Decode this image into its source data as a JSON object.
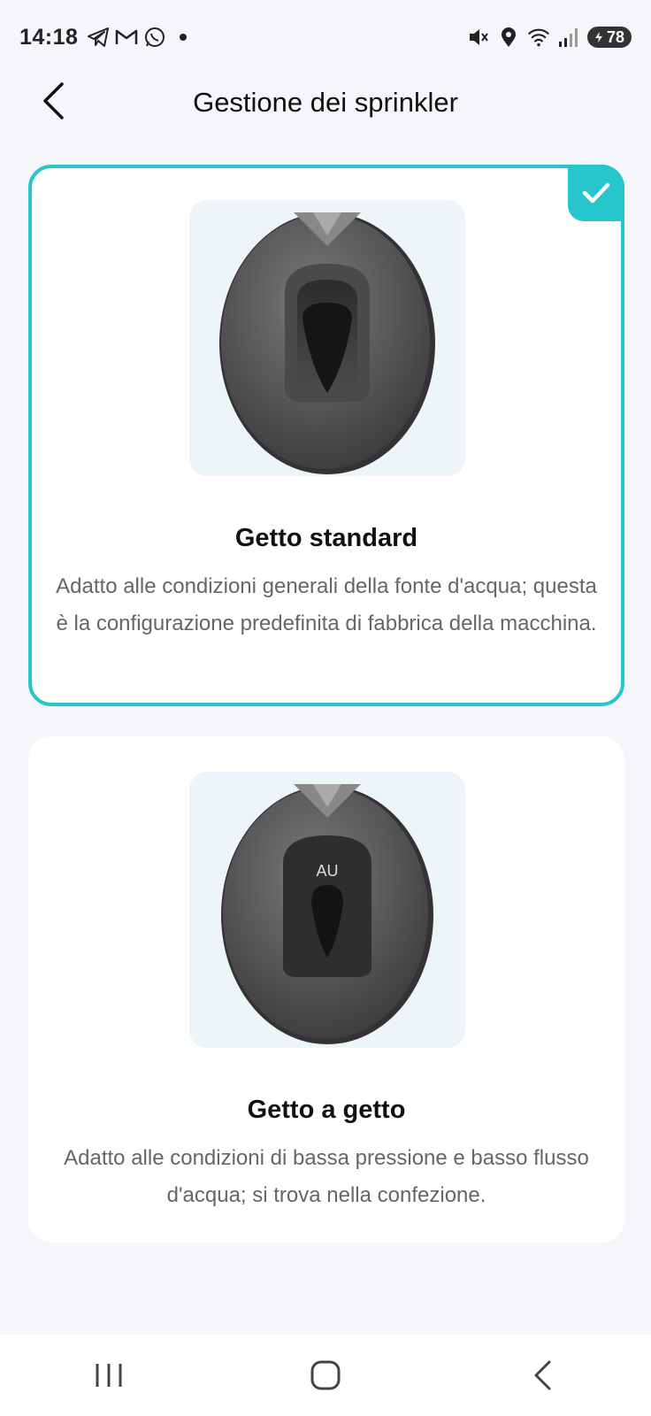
{
  "status_bar": {
    "time": "14:18",
    "battery": "78",
    "left_icons": [
      "telegram-icon",
      "gmail-icon",
      "whatsapp-icon",
      "dot-icon"
    ],
    "right_icons": [
      "mute-icon",
      "location-icon",
      "wifi-icon",
      "signal-icon",
      "battery-icon"
    ]
  },
  "header": {
    "title": "Gestione dei sprinkler",
    "back_icon": "chevron-left-icon"
  },
  "options": [
    {
      "title": "Getto standard",
      "description": "Adatto alle condizioni generali della fonte d'acqua; questa è la configurazione predefinita di fabbrica della macchina.",
      "selected": true,
      "image_label": ""
    },
    {
      "title": "Getto a getto",
      "description": "Adatto alle condizioni di bassa pressione e basso flusso d'acqua; si trova nella confezione.",
      "selected": false,
      "image_label": "AU"
    }
  ],
  "colors": {
    "accent": "#26c6cc",
    "background": "#f5f6fa",
    "card": "#ffffff",
    "image_bg": "#eef5f8",
    "text_primary": "#111111",
    "text_secondary": "#666666"
  },
  "nav_bar": {
    "buttons": [
      "recent-apps-icon",
      "home-icon",
      "back-icon"
    ]
  }
}
